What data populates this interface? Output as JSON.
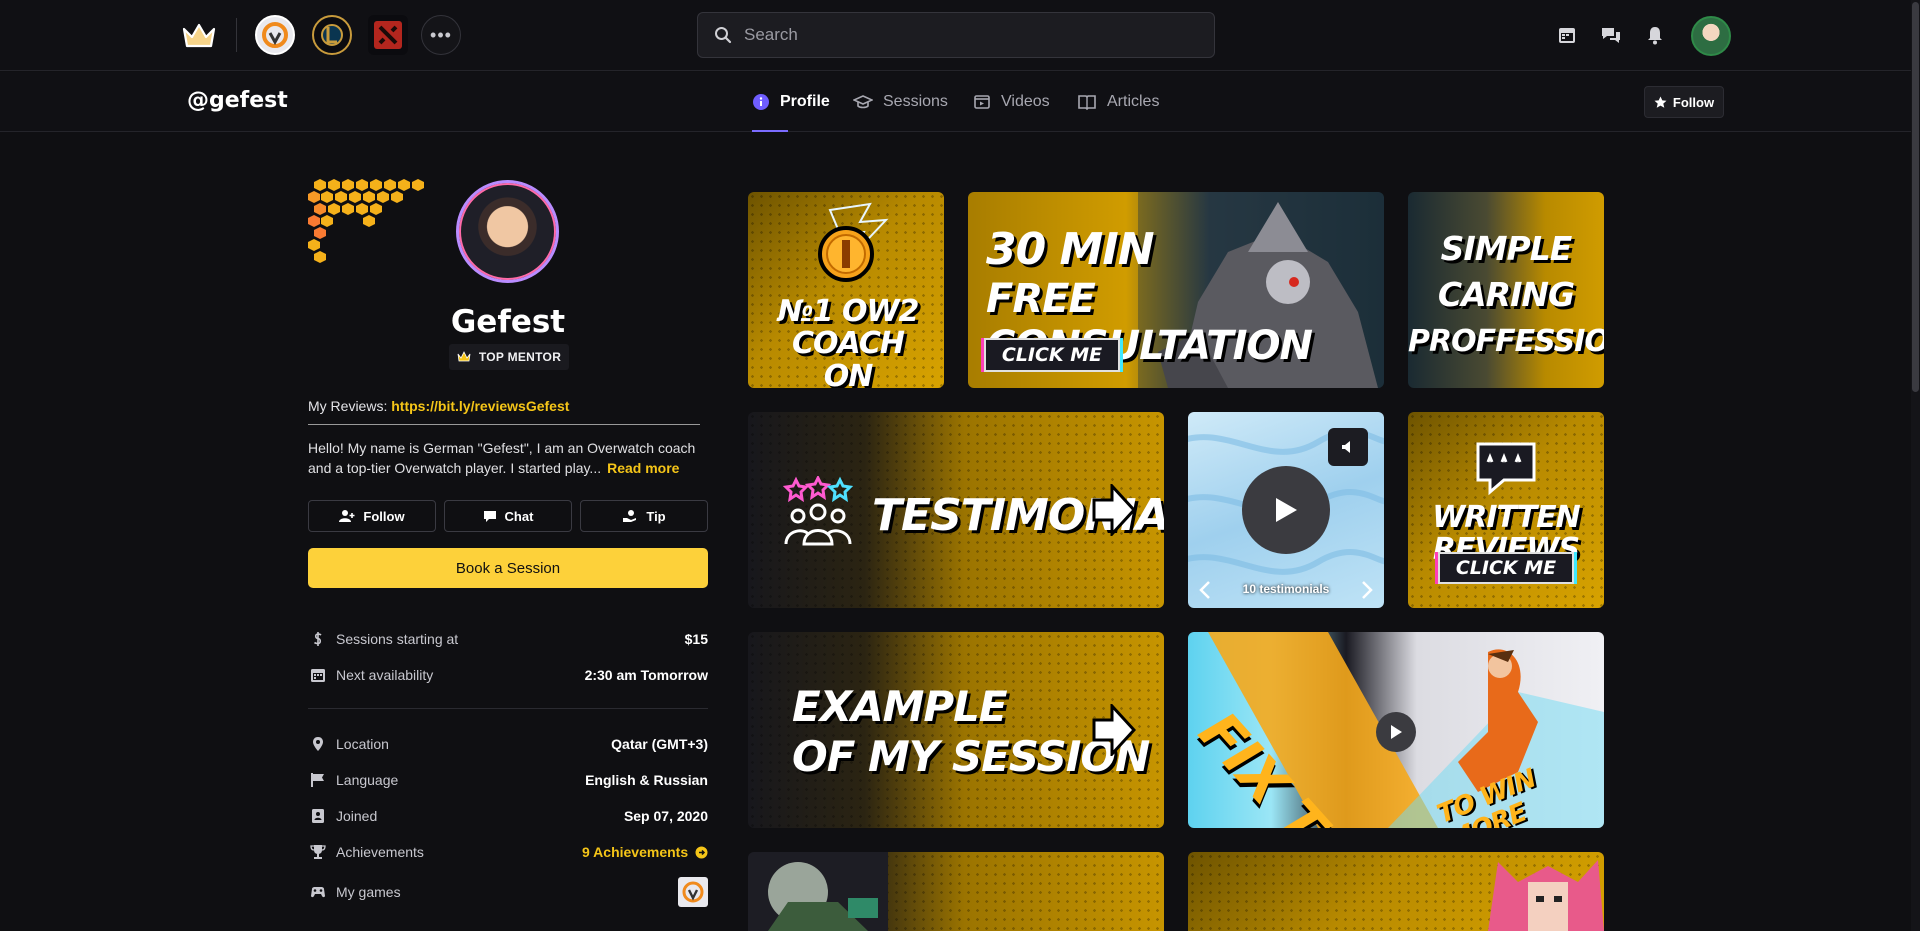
{
  "topbar": {
    "search_placeholder": "Search",
    "more_label": "•••"
  },
  "subnav": {
    "handle": "@gefest",
    "tabs": [
      {
        "label": "Profile",
        "icon": "info-icon"
      },
      {
        "label": "Sessions",
        "icon": "graduation-cap-icon"
      },
      {
        "label": "Videos",
        "icon": "video-icon"
      },
      {
        "label": "Articles",
        "icon": "book-icon"
      }
    ],
    "follow_label": "Follow"
  },
  "profile": {
    "name": "Gefest",
    "badge": "TOP MENTOR",
    "reviews_prefix": "My Reviews:",
    "reviews_link": "https://bit.ly/reviewsGefest",
    "bio": "Hello! My name is German \"Gefest\", I am an Overwatch coach and a top-tier Overwatch player. I started play...",
    "read_more": "Read more",
    "buttons": {
      "follow": "Follow",
      "chat": "Chat",
      "tip": "Tip"
    },
    "book_label": "Book a Session",
    "stats": [
      {
        "label": "Sessions starting at",
        "value": "$15",
        "icon": "dollar-icon"
      },
      {
        "label": "Next availability",
        "value": "2:30 am Tomorrow",
        "icon": "calendar-icon"
      }
    ],
    "details": [
      {
        "label": "Location",
        "value": "Qatar (GMT+3)",
        "icon": "location-pin-icon"
      },
      {
        "label": "Language",
        "value": "English & Russian",
        "icon": "flag-icon"
      },
      {
        "label": "Joined",
        "value": "Sep 07, 2020",
        "icon": "id-card-icon"
      },
      {
        "label": "Achievements",
        "value": "9 Achievements",
        "icon": "trophy-icon"
      },
      {
        "label": "My games",
        "value": "",
        "icon": "gamepad-icon"
      }
    ]
  },
  "tiles": {
    "coach": [
      "№1 OW2 COACH",
      "ON METAFY"
    ],
    "consult": [
      "30 MIN",
      "FREE CONSULTATION"
    ],
    "consult_cta": "CLICK ME",
    "simple": [
      "SIMPLE",
      "CARING",
      "PROFFESSIONAL"
    ],
    "testimonials": "TESTIMONIALS",
    "testimonial_count": "10 testimonials",
    "written": "WRITTEN REVIEWS",
    "written_cta": "CLICK ME",
    "example": [
      "EXAMPLE",
      "OF MY SESSION"
    ],
    "fix_this": "FIX THIS",
    "to_win_more": "TO WIN MORE"
  },
  "colors": {
    "accent_gold": "#fdd13a",
    "tab_underline": "#7b6cff",
    "background": "#0f0f12"
  }
}
